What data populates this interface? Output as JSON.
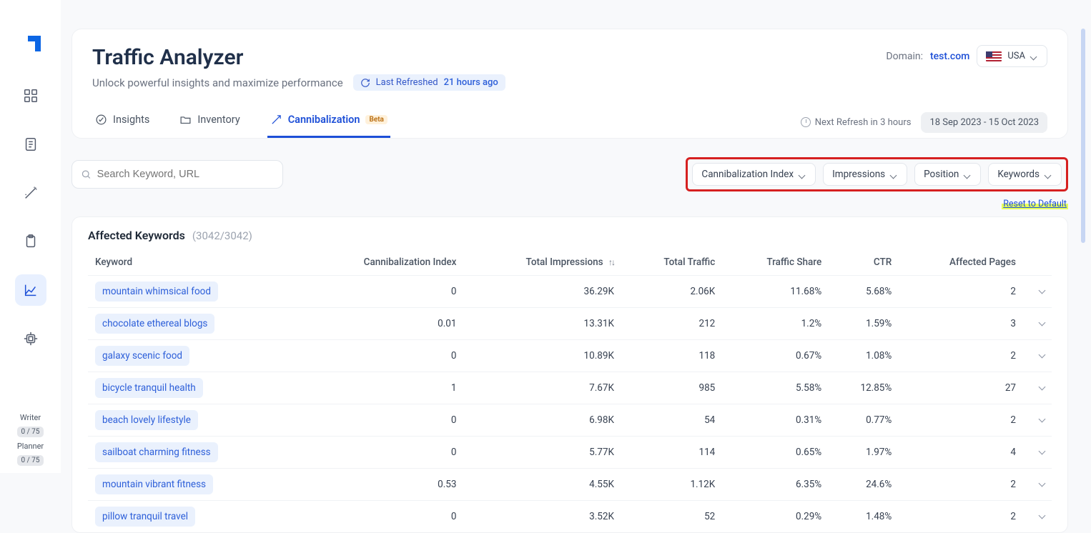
{
  "sidebar": {
    "bottom": {
      "writer_label": "Writer",
      "writer_count": "0 / 75",
      "planner_label": "Planner",
      "planner_count": "0 / 75"
    }
  },
  "header": {
    "title": "Traffic Analyzer",
    "subtitle": "Unlock powerful insights and maximize performance",
    "refresh_label": "Last Refreshed",
    "refresh_value": "21 hours ago",
    "domain_label": "Domain:",
    "domain_value": "test.com",
    "country": "USA"
  },
  "tabs": {
    "insights": "Insights",
    "inventory": "Inventory",
    "cannibalization": "Cannibalization",
    "beta": "Beta",
    "next_refresh": "Next Refresh in 3 hours",
    "date_range": "18 Sep 2023 - 15 Oct 2023"
  },
  "search": {
    "placeholder": "Search Keyword, URL"
  },
  "filters": {
    "ci": "Cannibalization Index",
    "impressions": "Impressions",
    "position": "Position",
    "keywords": "Keywords",
    "reset": "Reset to Default"
  },
  "table": {
    "title": "Affected Keywords",
    "count": "(3042/3042)",
    "headers": {
      "keyword": "Keyword",
      "ci": "Cannibalization Index",
      "impressions": "Total Impressions",
      "traffic": "Total Traffic",
      "share": "Traffic Share",
      "ctr": "CTR",
      "pages": "Affected Pages"
    },
    "rows": [
      {
        "keyword": "mountain whimsical food",
        "ci": "0",
        "impressions": "36.29K",
        "traffic": "2.06K",
        "share": "11.68%",
        "ctr": "5.68%",
        "pages": "2"
      },
      {
        "keyword": "chocolate ethereal blogs",
        "ci": "0.01",
        "impressions": "13.31K",
        "traffic": "212",
        "share": "1.2%",
        "ctr": "1.59%",
        "pages": "3"
      },
      {
        "keyword": "galaxy scenic food",
        "ci": "0",
        "impressions": "10.89K",
        "traffic": "118",
        "share": "0.67%",
        "ctr": "1.08%",
        "pages": "2"
      },
      {
        "keyword": "bicycle tranquil health",
        "ci": "1",
        "impressions": "7.67K",
        "traffic": "985",
        "share": "5.58%",
        "ctr": "12.85%",
        "pages": "27"
      },
      {
        "keyword": "beach lovely lifestyle",
        "ci": "0",
        "impressions": "6.98K",
        "traffic": "54",
        "share": "0.31%",
        "ctr": "0.77%",
        "pages": "2"
      },
      {
        "keyword": "sailboat charming fitness",
        "ci": "0",
        "impressions": "5.77K",
        "traffic": "114",
        "share": "0.65%",
        "ctr": "1.97%",
        "pages": "4"
      },
      {
        "keyword": "mountain vibrant fitness",
        "ci": "0.53",
        "impressions": "4.55K",
        "traffic": "1.12K",
        "share": "6.35%",
        "ctr": "24.6%",
        "pages": "2"
      },
      {
        "keyword": "pillow tranquil travel",
        "ci": "0",
        "impressions": "3.52K",
        "traffic": "52",
        "share": "0.29%",
        "ctr": "1.48%",
        "pages": "2"
      }
    ]
  }
}
